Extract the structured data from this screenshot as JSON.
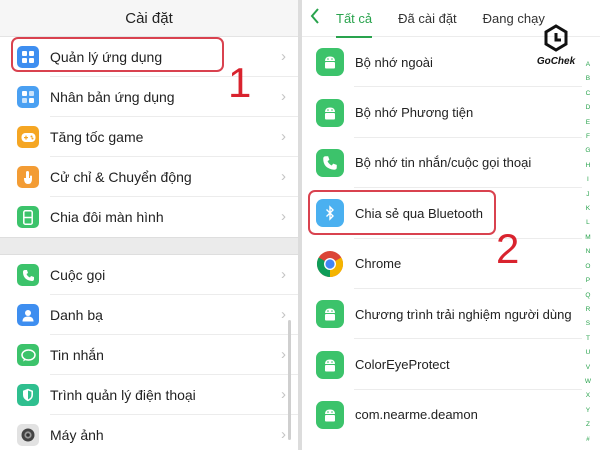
{
  "left": {
    "title": "Cài đặt",
    "group1": [
      {
        "label": "Quản lý ứng dụng",
        "icon": "grid-apps-icon"
      },
      {
        "label": "Nhân bản ứng dụng",
        "icon": "clone-apps-icon"
      },
      {
        "label": "Tăng tốc game",
        "icon": "gamepad-icon"
      },
      {
        "label": "Cử chỉ & Chuyển động",
        "icon": "hand-gesture-icon"
      },
      {
        "label": "Chia đôi màn hình",
        "icon": "split-screen-icon"
      }
    ],
    "group2": [
      {
        "label": "Cuộc gọi",
        "icon": "phone-icon"
      },
      {
        "label": "Danh bạ",
        "icon": "contacts-icon"
      },
      {
        "label": "Tin nhắn",
        "icon": "message-icon"
      },
      {
        "label": "Trình quản lý điện thoại",
        "icon": "shield-icon"
      },
      {
        "label": "Máy ảnh",
        "icon": "camera-icon"
      }
    ],
    "step_number": "1"
  },
  "right": {
    "tabs": [
      "Tất cả",
      "Đã cài đặt",
      "Đang chạy"
    ],
    "apps": [
      {
        "label": "Bộ nhớ ngoài",
        "icon": "android-icon"
      },
      {
        "label": "Bộ nhớ Phương tiện",
        "icon": "android-icon"
      },
      {
        "label": "Bộ nhớ tin nhắn/cuộc gọi thoại",
        "icon": "phone-icon"
      },
      {
        "label": "Chia sẻ qua Bluetooth",
        "icon": "bluetooth-icon"
      },
      {
        "label": "Chrome",
        "icon": "chrome-icon"
      },
      {
        "label": "Chương trình trải nghiệm người dùng",
        "icon": "android-icon"
      },
      {
        "label": "ColorEyeProtect",
        "icon": "android-icon"
      },
      {
        "label": "com.nearme.deamon",
        "icon": "android-icon"
      }
    ],
    "alphabet": [
      "A",
      "B",
      "C",
      "D",
      "E",
      "F",
      "G",
      "H",
      "I",
      "J",
      "K",
      "L",
      "M",
      "N",
      "O",
      "P",
      "Q",
      "R",
      "S",
      "T",
      "U",
      "V",
      "W",
      "X",
      "Y",
      "Z",
      "#"
    ],
    "step_number": "2",
    "brand": "GoChek"
  },
  "colors": {
    "accent": "#29a34d",
    "highlight": "#d9424f"
  }
}
